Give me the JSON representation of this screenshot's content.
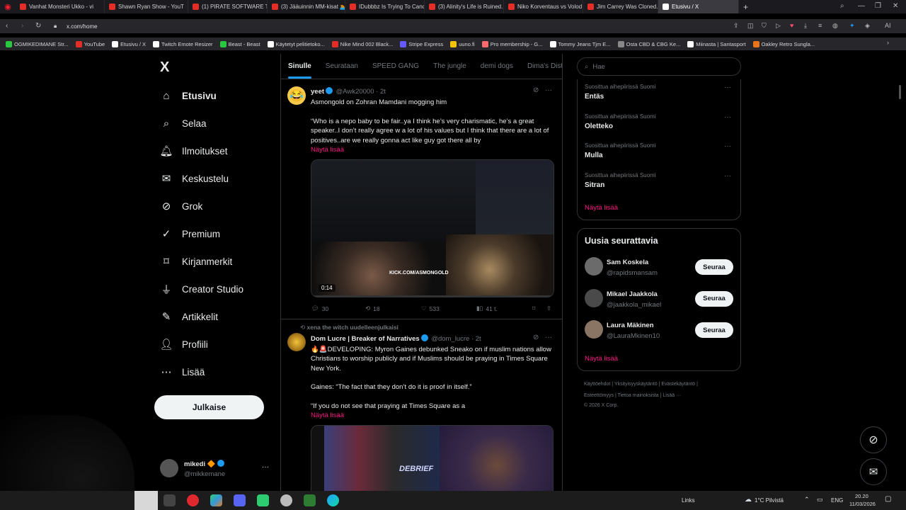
{
  "browser": {
    "tabs": [
      {
        "label": "Vanhat Monsteri Ukko - vi",
        "color": "#e52d27"
      },
      {
        "label": "Shawn Ryan Show - YouT",
        "color": "#e52d27"
      },
      {
        "label": "(1) PIRATE SOFTWARE TRI",
        "color": "#e52d27"
      },
      {
        "label": "(3) Jääuinnin MM-kisat 🏊",
        "color": "#e52d27"
      },
      {
        "label": "IDubbbz Is Trying To Canc",
        "color": "#e52d27"
      },
      {
        "label": "(3) Alinity's Life is Ruined.",
        "color": "#e52d27"
      },
      {
        "label": "Niko Korventaus vs Volod",
        "color": "#e52d27"
      },
      {
        "label": "Jim Carrey Was Cloned. H",
        "color": "#e52d27"
      },
      {
        "label": "Etusivu / X",
        "color": "#ffffff"
      }
    ],
    "url": "x.com/home",
    "bookmarks": [
      {
        "label": "OGMIKEDIMANE Str...",
        "color": "#28c840"
      },
      {
        "label": "YouTube",
        "color": "#e52d27"
      },
      {
        "label": "Etusivu / X",
        "color": "#ffffff"
      },
      {
        "label": "Twitch Emote Resizer",
        "color": "#ffffff"
      },
      {
        "label": "Beast - Beast",
        "color": "#28c840"
      },
      {
        "label": "Käytetyt pelitietoko...",
        "color": "#ffffff"
      },
      {
        "label": "Nike Mind 002 Black...",
        "color": "#e52d27"
      },
      {
        "label": "Stripe Express",
        "color": "#635bff"
      },
      {
        "label": "uuno.fi",
        "color": "#f5c400"
      },
      {
        "label": "Pro membership - G...",
        "color": "#ff6b6b"
      },
      {
        "label": "Tommy Jeans Tjm E...",
        "color": "#ffffff"
      },
      {
        "label": "Osta CBD & CBG Ke...",
        "color": "#888888"
      },
      {
        "label": "Miinasta | Santasport",
        "color": "#ffffff"
      },
      {
        "label": "Oakley Retro Sungla...",
        "color": "#e8741c"
      }
    ],
    "extension_label": "AI"
  },
  "nav": {
    "logo": "X",
    "items": [
      {
        "label": "Etusivu",
        "icon": "home-icon"
      },
      {
        "label": "Selaa",
        "icon": "search-icon"
      },
      {
        "label": "Ilmoitukset",
        "icon": "bell-icon"
      },
      {
        "label": "Keskustelu",
        "icon": "mail-icon"
      },
      {
        "label": "Grok",
        "icon": "grok-icon"
      },
      {
        "label": "Premium",
        "icon": "premium-icon"
      },
      {
        "label": "Kirjanmerkit",
        "icon": "bookmark-icon"
      },
      {
        "label": "Creator Studio",
        "icon": "creator-icon"
      },
      {
        "label": "Artikkelit",
        "icon": "article-icon"
      },
      {
        "label": "Profiili",
        "icon": "profile-icon"
      },
      {
        "label": "Lisää",
        "icon": "more-icon"
      }
    ],
    "post_button": "Julkaise",
    "account": {
      "name": "mikedi",
      "handle": "@mikkemane"
    }
  },
  "feed": {
    "tabs": [
      "Sinulle",
      "Seurataan",
      "SPEED GANG",
      "The jungle",
      "demi dogs",
      "Dima's Dist"
    ],
    "tweets": [
      {
        "name": "yeet",
        "handle": "@Awk20000",
        "time": "2t",
        "title": "Asmongold on Zohran Mamdani mogging him",
        "body": "“Who is a nepo baby to be fair..ya I think he’s very charismatic, he’s a great speaker..I don’t really agree w a lot of his values but I think that there are a lot of positives..are we really gonna act like guy got there all by",
        "show_more": "Näytä lisää",
        "video_time": "0:14",
        "overlay": "KICK.COM/ASMONGOLD",
        "replies": "30",
        "reposts": "18",
        "likes": "533",
        "views": "41 t."
      },
      {
        "repost_by": "xena the witch uudelleenjulkaisi",
        "name": "Dom Lucre | Breaker of Narratives",
        "handle": "@dom_lucre",
        "time": "2t",
        "body1": "🔥🚨DEVELOPING: Myron Gaines debunked Sneako on if muslim nations allow Christians to worship publicly and if Muslims should be praying in Times Square New York.",
        "body2": "Gaines: “The fact that they don’t do it is proof in itself.”",
        "body3": "“If you do not see that praying at Times Square as a",
        "show_more": "Näytä lisää",
        "overlay": "DEBRIEF"
      }
    ]
  },
  "right": {
    "search_placeholder": "Hae",
    "trends": [
      {
        "caption": "Suosittua aihepiirissä Suomi",
        "name": "Entäs"
      },
      {
        "caption": "Suosittua aihepiirissä Suomi",
        "name": "Oletteko"
      },
      {
        "caption": "Suosittua aihepiirissä Suomi",
        "name": "Mulla"
      },
      {
        "caption": "Suosittua aihepiirissä Suomi",
        "name": "Sitran"
      }
    ],
    "trends_more": "Näytä lisää",
    "who_title": "Uusia seurattavia",
    "who": [
      {
        "name": "Sam Koskela",
        "handle": "@rapidsmansam",
        "button": "Seuraa"
      },
      {
        "name": "Mikael Jaakkola",
        "handle": "@jaakkola_mikael",
        "button": "Seuraa"
      },
      {
        "name": "Laura Mäkinen",
        "handle": "@LauraMkinen10",
        "button": "Seuraa"
      }
    ],
    "who_more": "Näytä lisää",
    "footer1": "Käyttöehdot  |  Yksityisyyskäytäntö  |  Evästekäytäntö  |",
    "footer2": "Esteettömyys  |  Tietoa mainoksista  |  Lisää ···",
    "footer3": "© 2026 X Corp."
  },
  "taskbar": {
    "links": "Links",
    "weather": "1°C  Pilvistä",
    "lang": "ENG",
    "time": "20.20",
    "date": "11/03/2026"
  }
}
